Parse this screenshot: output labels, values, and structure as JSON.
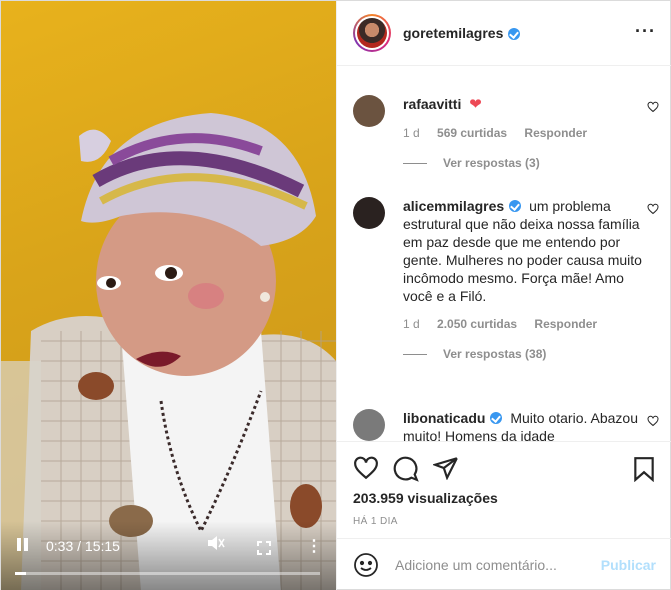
{
  "header": {
    "username": "goretemilagres",
    "verified": true
  },
  "video": {
    "time": "0:33 / 15:15",
    "progress": 0.036
  },
  "comments": [
    {
      "user": "rafaavitti",
      "text": "",
      "emoji": "heart",
      "age": "1 d",
      "likes": "569 curtidas",
      "reply_label": "Responder",
      "replies": "Ver respostas (3)",
      "avatar_color": "#6b5340"
    },
    {
      "user": "alicemmilagres",
      "verified": true,
      "text": "um problema estrutural que não deixa nossa família em paz desde que me entendo por gente. Mulheres no poder causa muito incômodo mesmo. Força mãe! Amo você e a Filó.",
      "age": "1 d",
      "likes": "2.050 curtidas",
      "reply_label": "Responder",
      "replies": "Ver respostas (38)",
      "avatar_color": "#2a2220"
    },
    {
      "user": "libonaticadu",
      "verified": true,
      "text": "Muito otario. Abazou muito! Homens da idade",
      "avatar_color": "#7a7a7a"
    }
  ],
  "stats": {
    "views": "203.959 visualizações",
    "date": "HÁ 1 DIA"
  },
  "add_comment": {
    "placeholder": "Adicione um comentário...",
    "post_label": "Publicar"
  },
  "colors": {
    "accent": "#3897f0",
    "publish": "#b2dffc",
    "heart": "#ed4956"
  },
  "icons": [
    "like-icon",
    "comment-icon",
    "share-icon",
    "save-icon",
    "emoji-icon",
    "more-options-icon"
  ]
}
